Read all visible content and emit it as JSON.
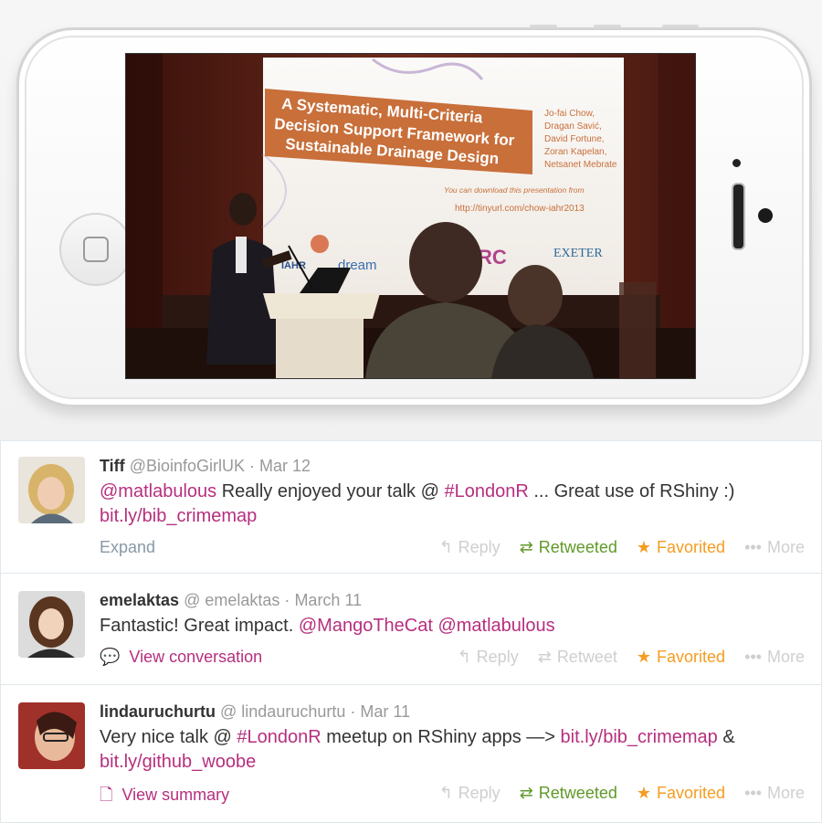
{
  "slide": {
    "title_lines": [
      "A Systematic, Multi-Criteria",
      "Decision Support Framework for",
      "Sustainable Drainage Design"
    ],
    "authors": [
      "Jo-fai Chow,",
      "Dragan Savić,",
      "David Fortune,",
      "Zoran Kapelan,",
      "Netsanet Mebrate"
    ],
    "download_note": "You can download this presentation from",
    "download_url": "http://tinyurl.com/chow-iahr2013",
    "logos": [
      "IAHR",
      "dream",
      "RC",
      "EXETER"
    ]
  },
  "tweets": [
    {
      "fullname": "Tiff",
      "username": "@BioinfoGirlUK",
      "separator": "·",
      "date": "Mar 12",
      "text_parts": [
        "@matlabulous",
        " Really enjoyed your talk @ ",
        "#LondonR",
        " ... Great use of RShiny :) ",
        "bit.ly/bib_crimemap"
      ],
      "footer_link": "Expand",
      "actions": {
        "reply": "Reply",
        "retweet": "Retweeted",
        "favorite": "Favorited",
        "more": "More"
      }
    },
    {
      "fullname": "emelaktas",
      "username": "@ emelaktas",
      "separator": "·",
      "date": "March 11",
      "text_parts": [
        "Fantastic! Great impact. ",
        "@MangoTheCat",
        " ",
        "@matlabulous"
      ],
      "footer_link": "View conversation",
      "actions": {
        "reply": "Reply",
        "retweet": "Retweet",
        "favorite": "Favorited",
        "more": "More"
      }
    },
    {
      "fullname": "lindauruchurtu",
      "username": "@ lindauruchurtu",
      "separator": "·",
      "date": "Mar 11",
      "text_parts": [
        "Very nice talk @ ",
        "#LondonR",
        " meetup on RShiny apps —> ",
        "bit.ly/bib_crimemap",
        " & ",
        "bit.ly/github_woobe"
      ],
      "footer_link": "View summary",
      "actions": {
        "reply": "Reply",
        "retweet": "Retweeted",
        "favorite": "Favorited",
        "more": "More"
      }
    }
  ],
  "colors": {
    "link": "#b62f7e",
    "retweeted": "#609928",
    "favorited": "#f49d21",
    "muted": "#999999"
  },
  "icons": [
    "home-button-icon",
    "reply-icon",
    "retweet-icon",
    "star-icon",
    "more-dots-icon",
    "speech-bubble-icon",
    "document-icon"
  ]
}
